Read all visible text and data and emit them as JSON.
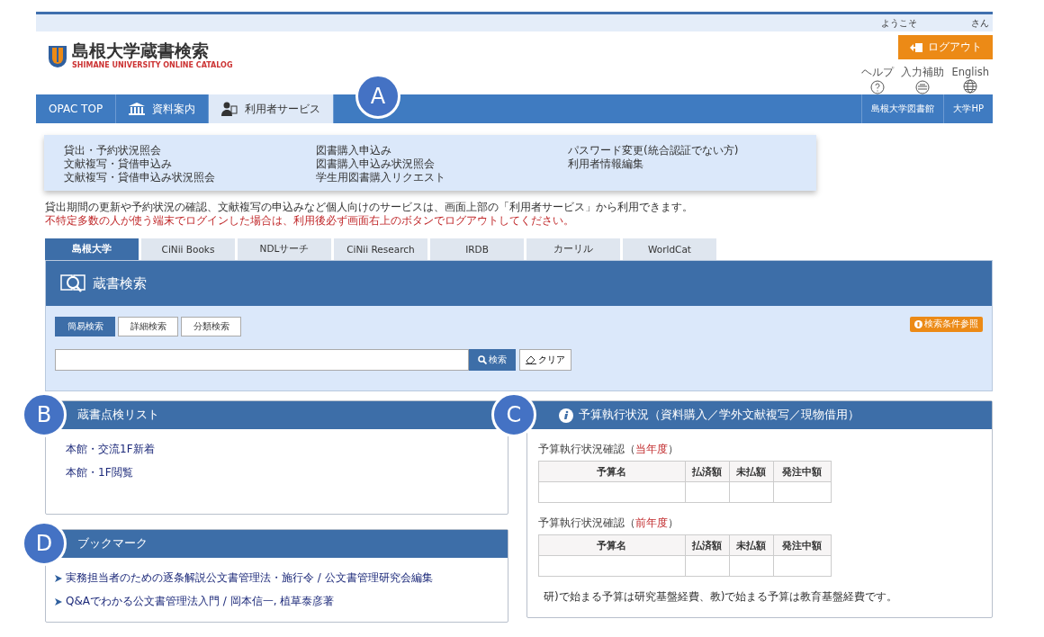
{
  "header": {
    "welcome": "ようこそ",
    "user_suffix": "さん",
    "logo_title": "島根大学蔵書検索",
    "logo_subtitle": "SHIMANE UNIVERSITY ONLINE CATALOG",
    "logout": "ログアウト",
    "utilities": [
      {
        "label": "ヘルプ",
        "kind": "help"
      },
      {
        "label": "入力補助",
        "kind": "keyboard"
      },
      {
        "label": "English",
        "kind": "globe"
      }
    ]
  },
  "nav": {
    "callout": "A",
    "left": [
      {
        "label": "OPAC TOP",
        "kind": "text",
        "selected": false
      },
      {
        "label": "資料案内",
        "kind": "building",
        "selected": false
      },
      {
        "label": "利用者サービス",
        "kind": "user",
        "selected": true
      }
    ],
    "right": [
      "島根大学図書館",
      "大学HP"
    ]
  },
  "dropdown": {
    "columns": [
      [
        "貸出・予約状況照会",
        "文献複写・貸借申込み",
        "文献複写・貸借申込み状況照会"
      ],
      [
        "図書購入申込み",
        "図書購入申込み状況照会",
        "学生用図書購入リクエスト"
      ],
      [
        "パスワード変更(統合認証でない方)",
        "利用者情報編集"
      ]
    ]
  },
  "notice": {
    "lines": [
      "貸出期間の更新や予約状況の確認、文献複写の申込みなど個人向けのサービスは、画面上部の「利用者サービス」から利用できます。"
    ],
    "warning": "不特定多数の人が使う端末でログインした場合は、利用後必ず画面右上のボタンでログアウトしてください。"
  },
  "source_tabs": [
    {
      "label": "島根大学",
      "selected": true
    },
    {
      "label": "CiNii Books",
      "selected": false
    },
    {
      "label": "NDLサーチ",
      "selected": false
    },
    {
      "label": "CiNii Research",
      "selected": false
    },
    {
      "label": "IRDB",
      "selected": false
    },
    {
      "label": "カーリル",
      "selected": false
    },
    {
      "label": "WorldCat",
      "selected": false
    }
  ],
  "search": {
    "title": "蔵書検索",
    "modes": [
      {
        "label": "簡易検索",
        "selected": true
      },
      {
        "label": "詳細検索",
        "selected": false
      },
      {
        "label": "分類検索",
        "selected": false
      }
    ],
    "conditions": "検索条件参照",
    "search_button": "検索",
    "clear_button": "クリア"
  },
  "inventory": {
    "callout": "B",
    "title": "蔵書点検リスト",
    "items": [
      "本館・交流1F新着",
      "本館・1F閲覧"
    ]
  },
  "bookmarks": {
    "callout": "D",
    "title": "ブックマーク",
    "items": [
      "実務担当者のための逐条解説公文書管理法・施行令 / 公文書管理研究会編集",
      "Q&Aでわかる公文書管理法入門 / 岡本信一, 植草泰彦著"
    ]
  },
  "budget": {
    "callout": "C",
    "title": "予算執行状況（資料購入／学外文献複写／現物借用）",
    "tables": [
      {
        "caption": "予算執行状況確認（",
        "period": "当年度",
        "caption_end": "）",
        "columns": [
          "予算名",
          "払済額",
          "未払額",
          "発注中額"
        ]
      },
      {
        "caption": "予算執行状況確認（",
        "period": "前年度",
        "caption_end": "）",
        "columns": [
          "予算名",
          "払済額",
          "未払額",
          "発注中額"
        ]
      }
    ],
    "notes": [
      "研)で始まる予算は研究基盤経費、教)で始まる予算は教育基盤経費です。"
    ]
  }
}
